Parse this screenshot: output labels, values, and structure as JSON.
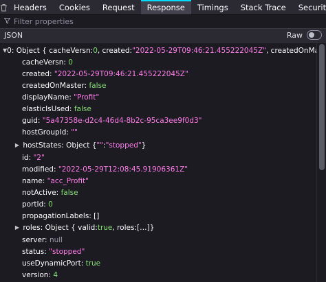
{
  "tabs": [
    "Headers",
    "Cookies",
    "Request",
    "Response",
    "Timings",
    "Stack Trace",
    "Security"
  ],
  "active_tab": "Response",
  "filter": {
    "placeholder": "Filter properties"
  },
  "json_label": "JSON",
  "raw_label": "Raw",
  "raw_enabled": false,
  "root": {
    "label": "0:",
    "summary_prefix": "Object { cacheVersn: ",
    "summary_cache": "0",
    "summary_mid": ", created: ",
    "summary_created": "\"2022-05-29T09:46:21.455222045Z\"",
    "summary_mid2": ", createdOnMaster: ",
    "summary_com": "false",
    "summary_end": ", … }"
  },
  "fields": {
    "cacheVersn": {
      "key": "cacheVersn:",
      "value": "0"
    },
    "created": {
      "key": "created:",
      "value": "\"2022-05-29T09:46:21.455222045Z\""
    },
    "createdOnMaster": {
      "key": "createdOnMaster:",
      "value": "false"
    },
    "displayName": {
      "key": "displayName:",
      "value": "\"Profit\""
    },
    "elasticIsUsed": {
      "key": "elasticIsUsed:",
      "value": "false"
    },
    "guid": {
      "key": "guid:",
      "value": "\"5a47358e-d2c4-46d4-8b2c-95ca3ee9f0d3\""
    },
    "hostGroupId": {
      "key": "hostGroupId:",
      "value": "\"\""
    },
    "hostStates": {
      "key": "hostStates:",
      "pre": "Object { ",
      "inner_key": "\"\"",
      "colon": ": ",
      "inner_val": "\"stopped\"",
      "post": " }"
    },
    "id": {
      "key": "id:",
      "value": "\"2\""
    },
    "modified": {
      "key": "modified:",
      "value": "\"2022-05-29T12:08:45.91906361Z\""
    },
    "name": {
      "key": "name:",
      "value": "\"acc_Profit\""
    },
    "notActive": {
      "key": "notActive:",
      "value": "false"
    },
    "portId": {
      "key": "portId:",
      "value": "0"
    },
    "propagationLabels": {
      "key": "propagationLabels:",
      "value": "[]"
    },
    "roles": {
      "key": "roles:",
      "pre": "Object { valid: ",
      "valid": "true",
      "mid": ", roles: ",
      "arr": "[…]",
      "post": " }"
    },
    "server": {
      "key": "server:",
      "value": "null"
    },
    "status": {
      "key": "status:",
      "value": "\"stopped\""
    },
    "useDynamicPort": {
      "key": "useDynamicPort:",
      "value": "true"
    },
    "version": {
      "key": "version:",
      "value": "4"
    }
  }
}
